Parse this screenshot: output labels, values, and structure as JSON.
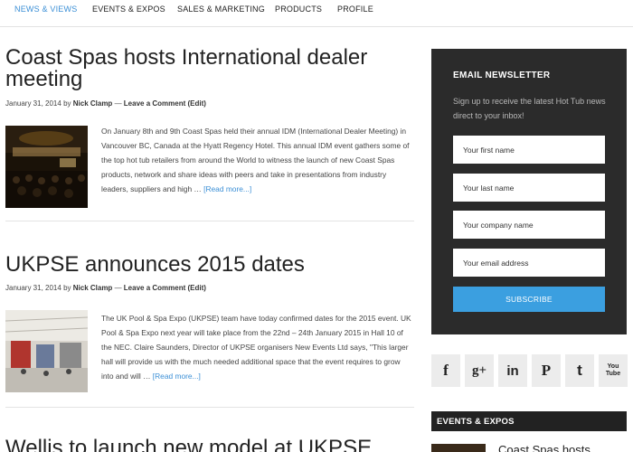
{
  "nav": {
    "items": [
      {
        "label": "NEWS & VIEWS",
        "active": true
      },
      {
        "label": "EVENTS & EXPOS",
        "active": false
      },
      {
        "label": "SALES & MARKETING",
        "active": false
      },
      {
        "label": "PRODUCTS",
        "active": false
      },
      {
        "label": "PROFILE",
        "active": false
      }
    ]
  },
  "posts": [
    {
      "title": "Coast Spas hosts International dealer meeting",
      "date": "January 31, 2014",
      "by": "by",
      "author": "Nick Clamp",
      "dash": "—",
      "comment_link": "Leave a Comment",
      "edit_link": "(Edit)",
      "excerpt": "On January 8th and 9th Coast Spas held their annual IDM (International Dealer Meeting) in Vancouver BC, Canada at the Hyatt Regency Hotel. This annual IDM event gathers some of the top hot tub retailers from around the World to witness the launch of new Coast Spas products, network and share ideas with peers and take in presentations from industry leaders, suppliers and high …",
      "read_more": "[Read more...]"
    },
    {
      "title": "UKPSE announces 2015 dates",
      "date": "January 31, 2014",
      "by": "by",
      "author": "Nick Clamp",
      "dash": "—",
      "comment_link": "Leave a Comment",
      "edit_link": "(Edit)",
      "excerpt": "The UK Pool & Spa Expo (UKPSE) team have today confirmed dates for the 2015 event. UK Pool & Spa Expo next year will take place from the 22nd – 24th January 2015 in Hall 10 of the NEC. Claire Saunders, Director of UKPSE organisers New Events Ltd says, \"This larger hall will provide us with the much needed additional space that the event requires to grow into and will …",
      "read_more": "[Read more...]"
    },
    {
      "title": "Wellis to launch new model at UKPSE"
    }
  ],
  "newsletter": {
    "title": "EMAIL NEWSLETTER",
    "description": "Sign up to receive the latest Hot Tub news direct to your inbox!",
    "fields": [
      {
        "placeholder": "Your first name"
      },
      {
        "placeholder": "Your last name"
      },
      {
        "placeholder": "Your company name"
      },
      {
        "placeholder": "Your email address"
      }
    ],
    "button": "SUBSCRIBE",
    "accent": "#3b9fe0",
    "background": "#2b2b2b"
  },
  "social": [
    {
      "icon": "facebook-icon",
      "glyph": "f"
    },
    {
      "icon": "google-plus-icon",
      "glyph": "g+"
    },
    {
      "icon": "linkedin-icon",
      "glyph": "in"
    },
    {
      "icon": "pinterest-icon",
      "glyph": "P"
    },
    {
      "icon": "twitter-icon",
      "glyph": "t"
    },
    {
      "icon": "youtube-icon",
      "glyph": "You Tube"
    }
  ],
  "events_widget": {
    "title": "EVENTS & EXPOS",
    "first_item": "Coast Spas hosts"
  },
  "colors": {
    "link": "#3b8fd6"
  }
}
